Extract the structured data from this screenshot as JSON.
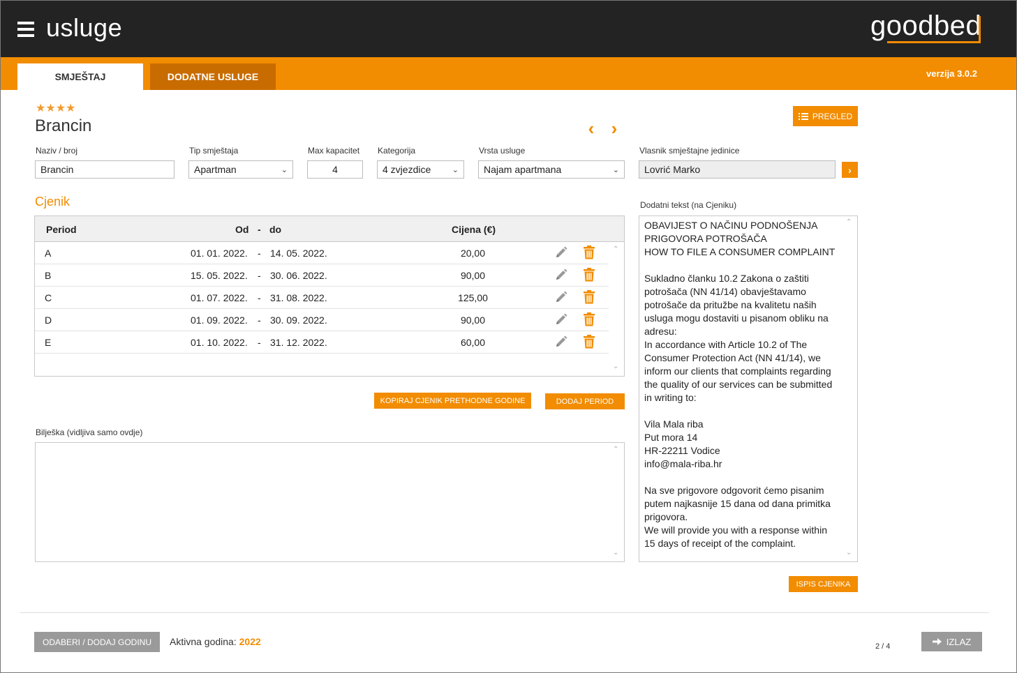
{
  "header": {
    "title": "usluge",
    "logo": "goodbed",
    "menu_icon": "hamburger-icon"
  },
  "tabs": [
    {
      "label": "SMJEŠTAJ",
      "active": true
    },
    {
      "label": "DODATNE USLUGE",
      "active": false
    }
  ],
  "version": "verzija 3.0.2",
  "unit": {
    "stars": "★★★★",
    "star_rating": 4,
    "name": "Brancin",
    "pregled_label": "PREGLED"
  },
  "form": {
    "naziv_label": "Naziv / broj",
    "naziv_value": "Brancin",
    "tip_label": "Tip smještaja",
    "tip_value": "Apartman",
    "kapacitet_label": "Max kapacitet",
    "kapacitet_value": "4",
    "kategorija_label": "Kategorija",
    "kategorija_value": "4 zvjezdice",
    "vrsta_label": "Vrsta usluge",
    "vrsta_value": "Najam apartmana",
    "vlasnik_label": "Vlasnik smještajne jedinice",
    "vlasnik_value": "Lovrić Marko"
  },
  "cjenik": {
    "title": "Cjenik",
    "headers": {
      "period": "Period",
      "od": "Od",
      "dash": "-",
      "do": "do",
      "cijena": "Cijena (€)"
    },
    "rows": [
      {
        "period": "A",
        "od": "01. 01. 2022.",
        "dash": "-",
        "do": "14. 05. 2022.",
        "cijena": "20,00"
      },
      {
        "period": "B",
        "od": "15. 05. 2022.",
        "dash": "-",
        "do": "30. 06. 2022.",
        "cijena": "90,00"
      },
      {
        "period": "C",
        "od": "01. 07. 2022.",
        "dash": "-",
        "do": "31. 08. 2022.",
        "cijena": "125,00"
      },
      {
        "period": "D",
        "od": "01. 09. 2022.",
        "dash": "-",
        "do": "30. 09. 2022.",
        "cijena": "90,00"
      },
      {
        "period": "E",
        "od": "01. 10. 2022.",
        "dash": "-",
        "do": "31. 12. 2022.",
        "cijena": "60,00"
      }
    ],
    "copy_btn": "KOPIRAJ CJENIK PRETHODNE GODINE",
    "add_btn": "DODAJ PERIOD"
  },
  "note": {
    "label": "Bilješka (vidljiva samo ovdje)",
    "value": ""
  },
  "extra_text": {
    "label": "Dodatni tekst (na Cjeniku)",
    "lines": [
      "OBAVIJEST O NAČINU PODNOŠENJA",
      "PRIGOVORA POTROŠAČA",
      "HOW TO FILE A CONSUMER COMPLAINT",
      "",
      "Sukladno članku 10.2 Zakona o zaštiti",
      "potrošača (NN 41/14) obavještavamo",
      "potrošače da pritužbe na kvalitetu naših",
      "usluga mogu dostaviti u pisanom obliku na",
      "adresu:",
      "In accordance with Article 10.2 of The",
      "Consumer Protection Act (NN 41/14), we",
      "inform our clients that complaints regarding",
      "the quality of our services can be submitted",
      "in writing to:",
      "",
      "Vila Mala riba",
      "Put mora 14",
      "HR-22211 Vodice",
      "info@mala-riba.hr",
      "",
      "Na sve prigovore odgovorit ćemo pisanim",
      "putem najkasnije 15 dana od dana primitka",
      "prigovora.",
      "We will provide you with a response within",
      "15 days of receipt of the complaint."
    ],
    "print_btn": "ISPIS CJENIKA"
  },
  "footer": {
    "year_btn": "ODABERI / DODAJ GODINU",
    "active_year_label": "Aktivna godina: ",
    "active_year": "2022",
    "page_count": "2 / 4",
    "exit_btn": "IZLAZ"
  },
  "colors": {
    "accent": "#F28C00",
    "header_bg": "#232323",
    "tab_dark": "#C96C00",
    "grey_btn": "#9a9a9a"
  }
}
